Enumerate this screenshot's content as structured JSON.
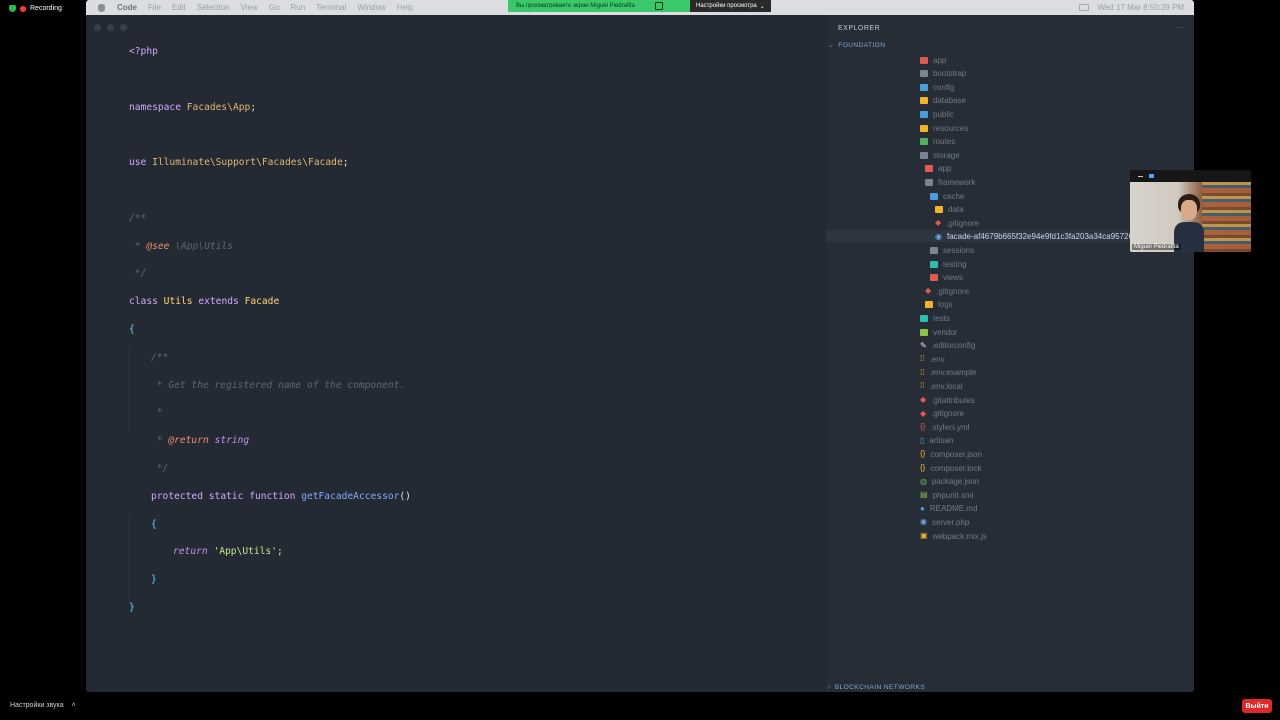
{
  "recording": {
    "label": "Recording"
  },
  "menubar": {
    "app": "Code",
    "items": [
      "File",
      "Edit",
      "Selection",
      "View",
      "Go",
      "Run",
      "Terminal",
      "Window",
      "Help"
    ],
    "datetime": "Wed 17 Mar  8:50:39 PM"
  },
  "share_bar": {
    "viewing_text": "Вы просматриваете экран Miguel Piedrafita",
    "view_options": "Настройки просмотра"
  },
  "code": {
    "lines": [
      "<?php",
      "namespace Facades\\App;",
      "use Illuminate\\Support\\Facades\\Facade;",
      "/**",
      " * @see \\App\\Utils",
      " */",
      "class Utils extends Facade",
      "{",
      "/**",
      " * Get the registered name of the component.",
      " *",
      " * @return string",
      " */",
      "protected static function getFacadeAccessor()",
      "{",
      "return 'App\\Utils';",
      "}",
      "}"
    ]
  },
  "explorer": {
    "title": "EXPLORER",
    "more": "···",
    "root_section": "FOUNDATION",
    "items": [
      {
        "label": "app",
        "color": "#e05a4f",
        "kind": "folder"
      },
      {
        "label": "bootstrap",
        "color": "#7a8594",
        "kind": "folder"
      },
      {
        "label": "config",
        "color": "#4a9fd8",
        "kind": "folder"
      },
      {
        "label": "database",
        "color": "#f0b429",
        "kind": "folder"
      },
      {
        "label": "public",
        "color": "#4a9fd8",
        "kind": "folder"
      },
      {
        "label": "resources",
        "color": "#f0b429",
        "kind": "folder"
      },
      {
        "label": "routes",
        "color": "#52b45a",
        "kind": "folder"
      },
      {
        "label": "storage",
        "color": "#7a8594",
        "kind": "folder"
      },
      {
        "label": "app",
        "color": "#e05a4f",
        "kind": "folder"
      },
      {
        "label": "framework",
        "color": "#7a8594",
        "kind": "folder"
      },
      {
        "label": "cache",
        "color": "#4a9fd8",
        "kind": "folder"
      },
      {
        "label": "data",
        "color": "#f0b429",
        "kind": "folder"
      },
      {
        "label": ".gitignore",
        "color": "#e05a4f",
        "kind": "git"
      },
      {
        "label": "facade-af4679b665f32e94e9fd1c3fa203a34ca9572662.php",
        "color": "#6ea7e0",
        "kind": "php"
      },
      {
        "label": "sessions",
        "color": "#7a8594",
        "kind": "folder"
      },
      {
        "label": "testing",
        "color": "#2fbfb0",
        "kind": "folder"
      },
      {
        "label": "views",
        "color": "#e05a4f",
        "kind": "folder"
      },
      {
        "label": ".gitignore",
        "color": "#e05a4f",
        "kind": "git"
      },
      {
        "label": "logs",
        "color": "#f0b429",
        "kind": "folder"
      },
      {
        "label": "tests",
        "color": "#2fbfb0",
        "kind": "folder"
      },
      {
        "label": "vendor",
        "color": "#8bc34a",
        "kind": "folder"
      },
      {
        "label": ".editorconfig",
        "color": "#e6e6e6",
        "kind": "edit"
      },
      {
        "label": ".env",
        "color": "#f0b429",
        "kind": "env"
      },
      {
        "label": ".env.example",
        "color": "#f0b429",
        "kind": "env"
      },
      {
        "label": ".env.local",
        "color": "#f0b429",
        "kind": "env"
      },
      {
        "label": ".gitattributes",
        "color": "#e05a4f",
        "kind": "git"
      },
      {
        "label": ".gitignore",
        "color": "#e05a4f",
        "kind": "git"
      },
      {
        "label": ".styleci.yml",
        "color": "#e05a4f",
        "kind": "yaml"
      },
      {
        "label": "artisan",
        "color": "#4a9fd8",
        "kind": "file"
      },
      {
        "label": "composer.json",
        "color": "#f0b429",
        "kind": "json"
      },
      {
        "label": "composer.lock",
        "color": "#f0b429",
        "kind": "json"
      },
      {
        "label": "package.json",
        "color": "#52b45a",
        "kind": "npm"
      },
      {
        "label": "phpunit.xml",
        "color": "#8bc34a",
        "kind": "xml"
      },
      {
        "label": "README.md",
        "color": "#4a9fd8",
        "kind": "info"
      },
      {
        "label": "server.php",
        "color": "#6ea7e0",
        "kind": "php"
      },
      {
        "label": "webpack.mix.js",
        "color": "#f0b429",
        "kind": "js"
      }
    ],
    "bottom_section": "BLOCKCHAIN NETWORKS"
  },
  "video": {
    "participant": "Miguel Piedrafita"
  },
  "zoom_bottom": {
    "audio_settings": "Настройки звука",
    "leave": "Выйти"
  }
}
